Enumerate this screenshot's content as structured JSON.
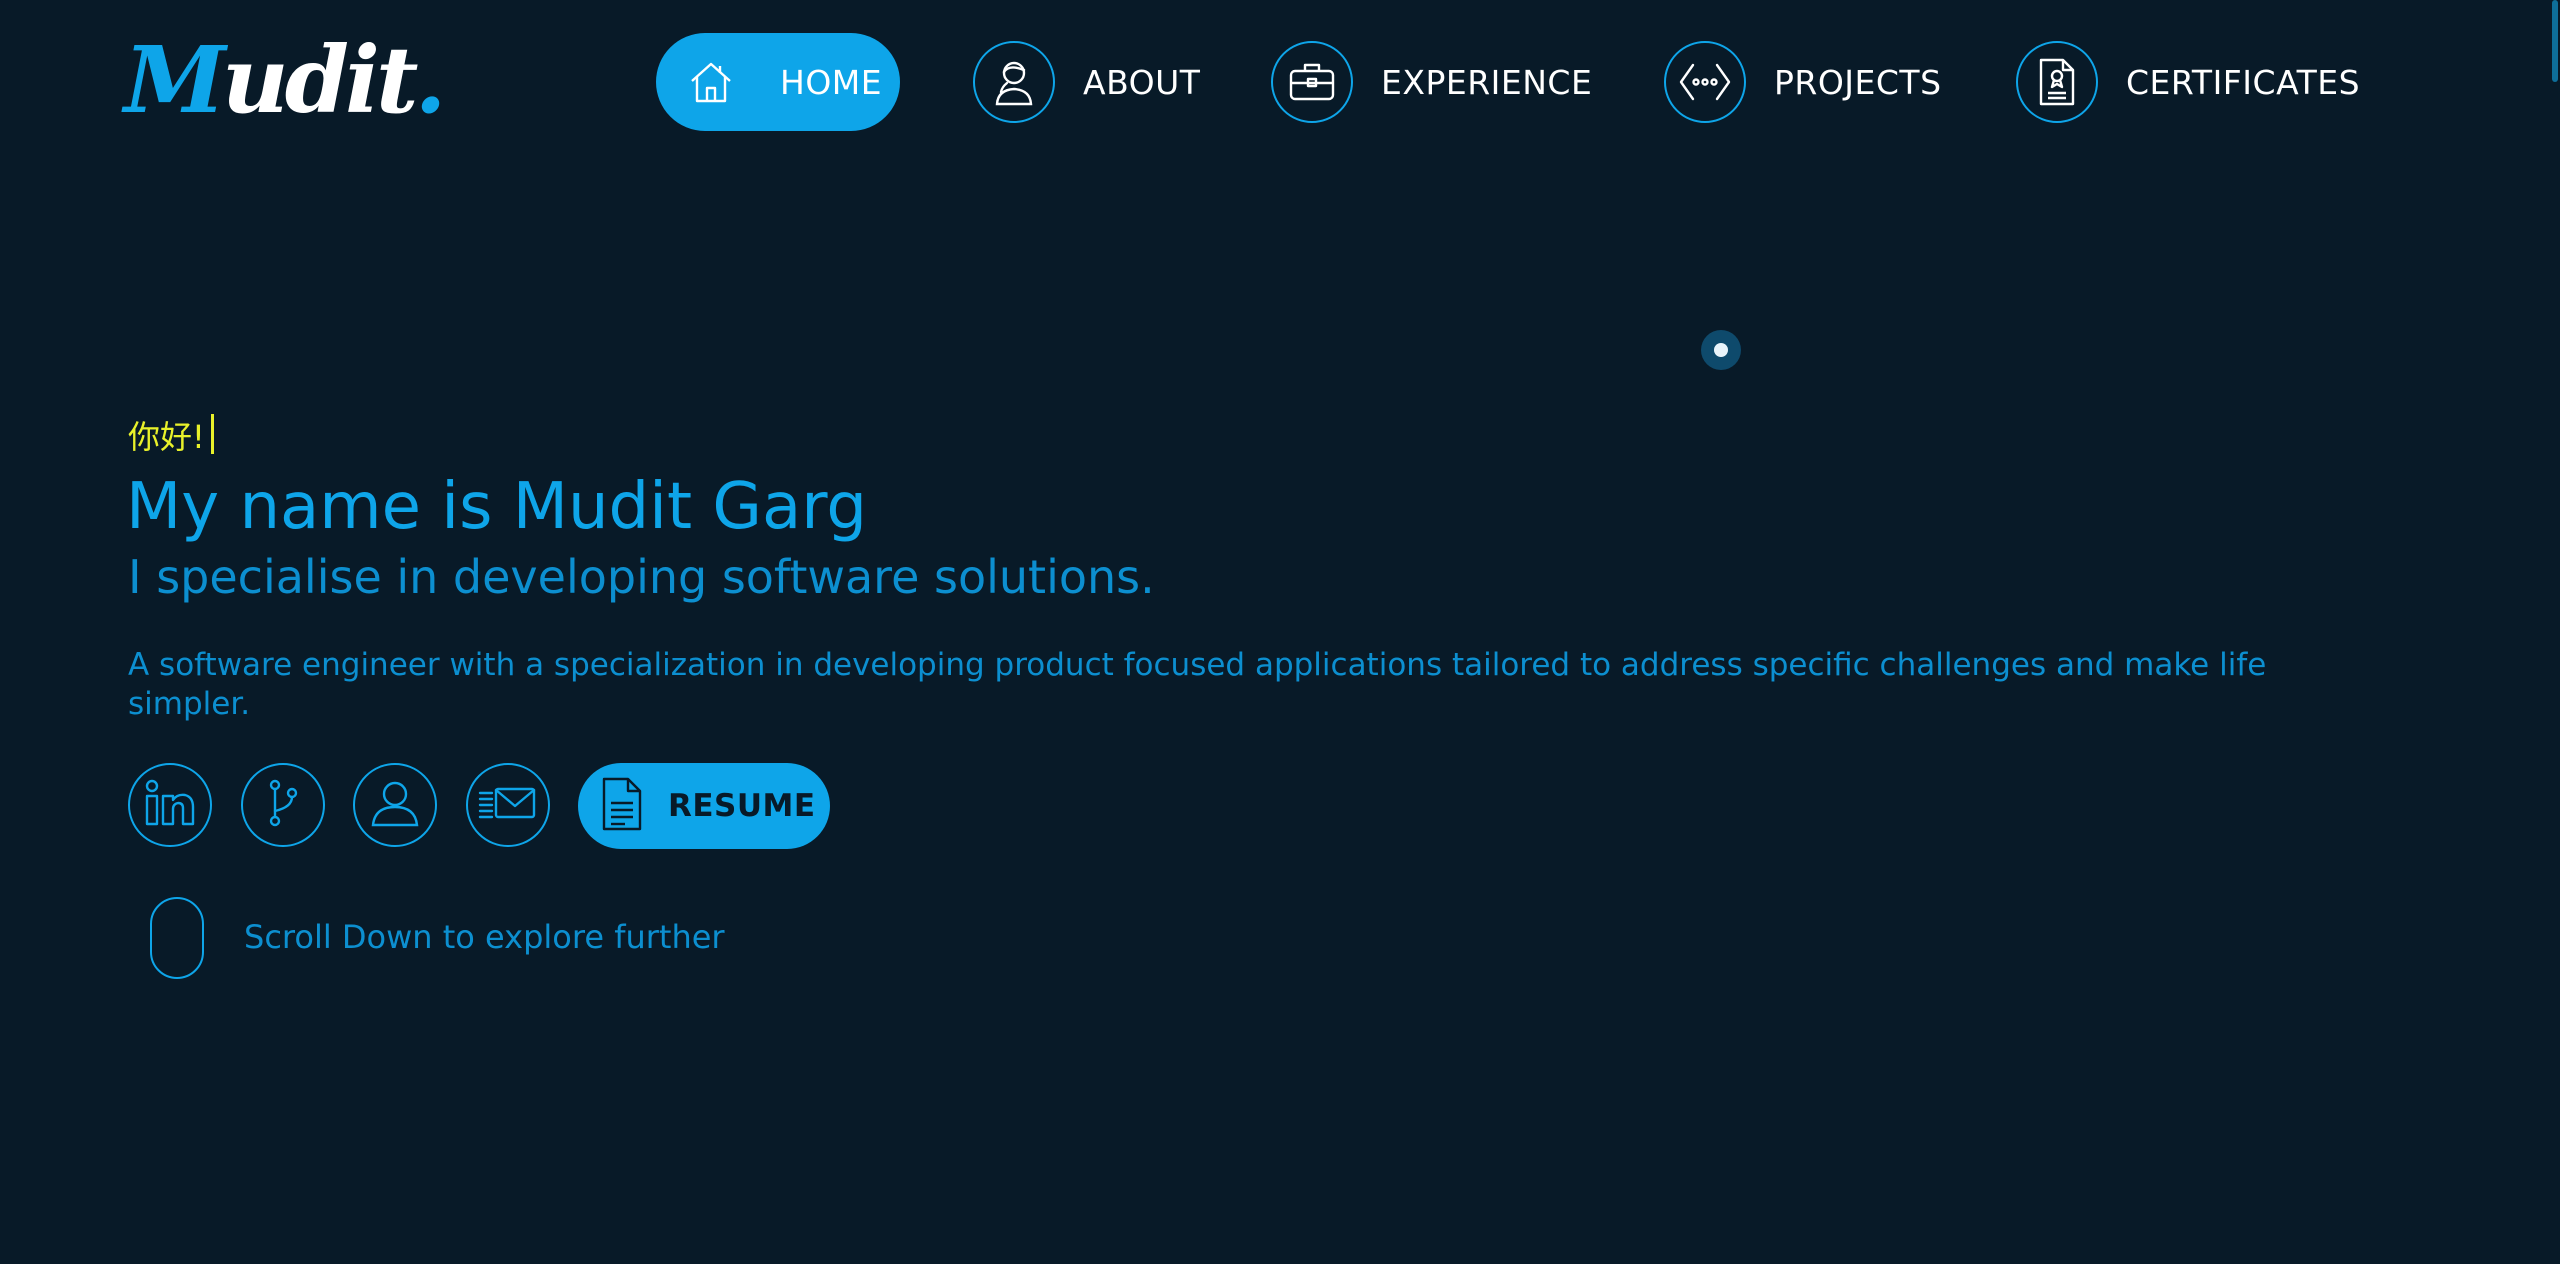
{
  "brand": {
    "logo_first": "M",
    "logo_rest": "udit",
    "logo_dot": "."
  },
  "nav": {
    "items": [
      {
        "label": "HOME",
        "icon": "home-icon",
        "active": true
      },
      {
        "label": "ABOUT",
        "icon": "person-icon",
        "active": false
      },
      {
        "label": "EXPERIENCE",
        "icon": "briefcase-icon",
        "active": false
      },
      {
        "label": "PROJECTS",
        "icon": "code-icon",
        "active": false
      },
      {
        "label": "CERTIFICATES",
        "icon": "certificate-icon",
        "active": false
      }
    ]
  },
  "hero": {
    "greeting": "你好!",
    "title": "My name is Mudit Garg",
    "subtitle": "I specialise in developing software solutions.",
    "description": "A software engineer with a specialization in developing product focused applications tailored to address specific challenges and make life simpler."
  },
  "social": [
    {
      "icon": "linkedin-icon"
    },
    {
      "icon": "git-branch-icon"
    },
    {
      "icon": "user-icon"
    },
    {
      "icon": "mail-icon"
    }
  ],
  "resume": {
    "label": "RESUME",
    "icon": "document-icon"
  },
  "scroll_hint": {
    "text": "Scroll Down to explore further",
    "icon": "mouse-icon"
  },
  "colors": {
    "background": "#081a28",
    "accent": "#0ea5e9",
    "greeting": "#e8f12a",
    "text": "#ffffff"
  }
}
